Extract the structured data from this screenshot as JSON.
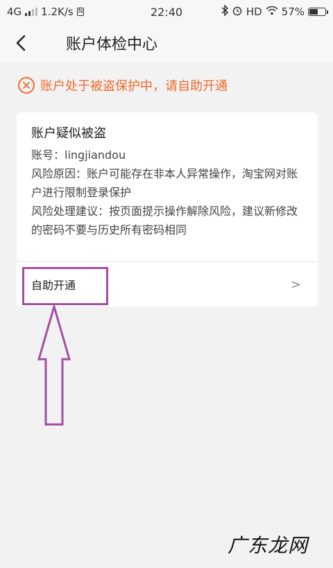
{
  "status_bar": {
    "network": "4G",
    "speed": "1.2K/s",
    "notify_badge": "N",
    "time": "22:40",
    "hd": "HD",
    "battery_percent": "57%",
    "battery_level": 0.57
  },
  "nav": {
    "title": "账户体检中心"
  },
  "warning": {
    "text": "账户处于被盗保护中，请自助开通"
  },
  "card": {
    "title": "账户疑似被盗",
    "account": "账号：lingjiandou",
    "reason": "风险原因：账户可能存在非本人异常操作，淘宝网对账户进行限制登录保护",
    "advice": "风险处理建议：按页面提示操作解除风险，建议新修改的密码不要与历史所有密码相同",
    "action_label": "自助开通",
    "action_chevron": ">"
  },
  "watermark": "广东龙网",
  "colors": {
    "warning": "#f06a2a",
    "highlight": "#a24fa2"
  }
}
